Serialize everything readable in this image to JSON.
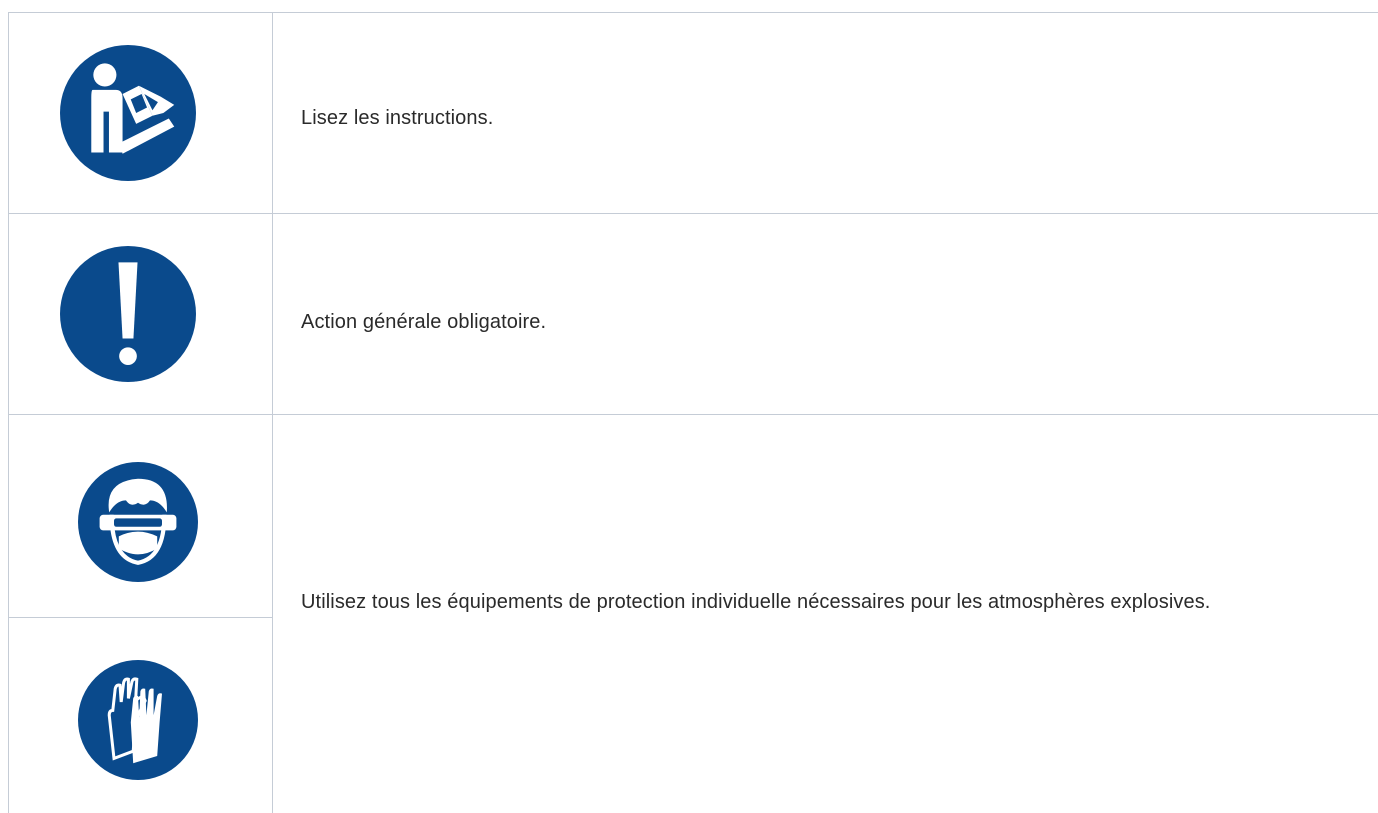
{
  "safety_table": {
    "rows": [
      {
        "text": "Lisez les instructions.",
        "icons": [
          "read-manual-icon"
        ]
      },
      {
        "text": "Action générale obligatoire.",
        "icons": [
          "exclamation-mandatory-icon"
        ]
      },
      {
        "text": "Utilisez tous les équipements de protection individuelle nécessaires pour les atmosphères explosives.",
        "icons": [
          "goggles-mask-icon",
          "gloves-icon"
        ]
      }
    ],
    "colors": {
      "icon_blue": "#0a4a8c",
      "border": "#c5ccd6",
      "text": "#2a2a2a"
    }
  }
}
